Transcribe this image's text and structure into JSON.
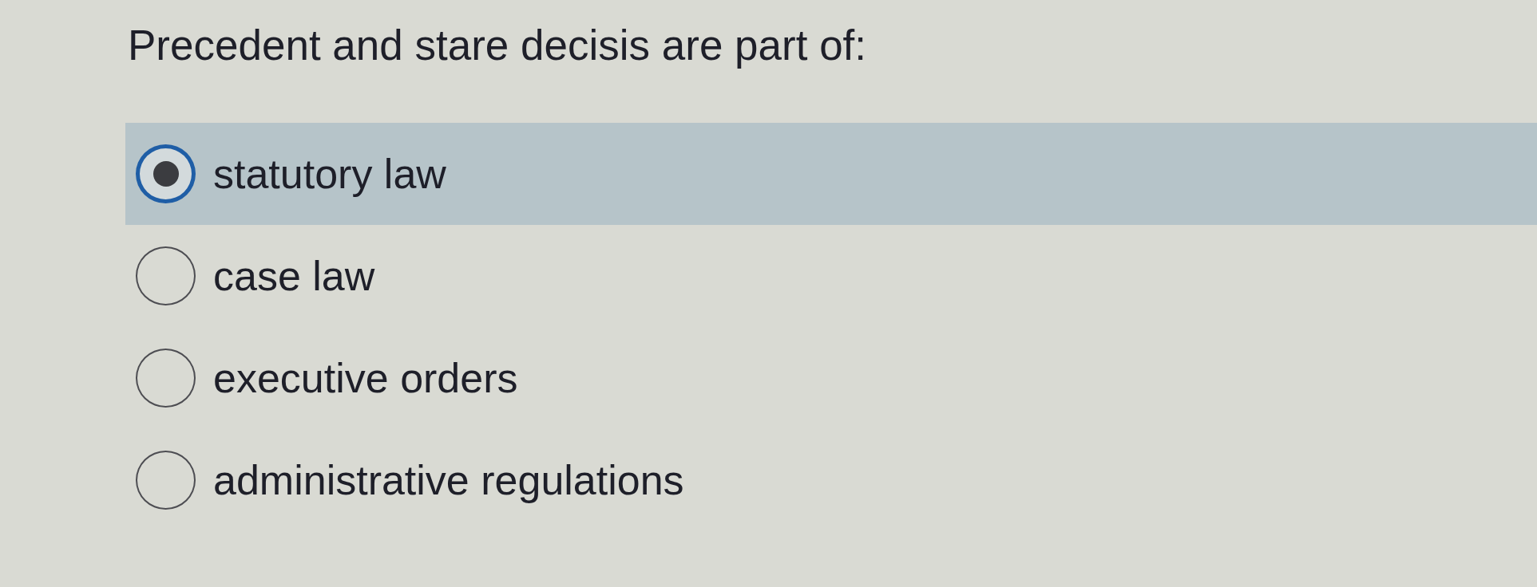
{
  "question": {
    "text": "Precedent and stare decisis are part of:"
  },
  "options": [
    {
      "label": "statutory law",
      "selected": true
    },
    {
      "label": "case law",
      "selected": false
    },
    {
      "label": "executive orders",
      "selected": false
    },
    {
      "label": "administrative regulations",
      "selected": false
    }
  ]
}
